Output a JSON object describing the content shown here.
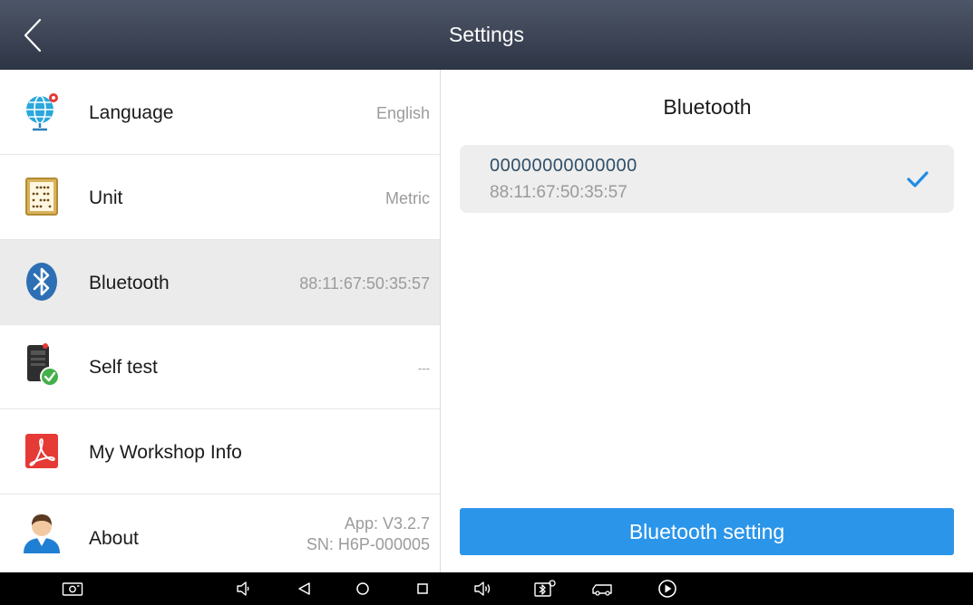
{
  "header": {
    "title": "Settings"
  },
  "list": [
    {
      "id": "language",
      "label": "Language",
      "value": "English",
      "icon": "globe-icon"
    },
    {
      "id": "unit",
      "label": "Unit",
      "value": "Metric",
      "icon": "abacus-icon"
    },
    {
      "id": "bluetooth",
      "label": "Bluetooth",
      "value": "88:11:67:50:35:57",
      "icon": "bluetooth-icon",
      "selected": true
    },
    {
      "id": "self-test",
      "label": "Self test",
      "value": "---",
      "icon": "device-check-icon"
    },
    {
      "id": "workshop",
      "label": "My Workshop Info",
      "value": "",
      "icon": "pdf-icon"
    },
    {
      "id": "about",
      "label": "About",
      "value_line1": "App: V3.2.7",
      "value_line2": "SN: H6P-000005",
      "icon": "user-icon"
    }
  ],
  "panel": {
    "title": "Bluetooth",
    "device": {
      "name": "00000000000000",
      "mac": "88:11:67:50:35:57",
      "connected": true
    },
    "button_label": "Bluetooth setting"
  },
  "navbar": {
    "icons": [
      "screenshot-icon",
      "volume-down-icon",
      "back-icon",
      "home-icon",
      "recents-icon",
      "volume-up-icon",
      "bluetooth-settings-icon",
      "vci-icon",
      "play-icon"
    ]
  },
  "colors": {
    "header": "#3a4253",
    "accent": "#2b95ea",
    "selected_row": "#ebebeb",
    "check": "#1e8de6"
  }
}
